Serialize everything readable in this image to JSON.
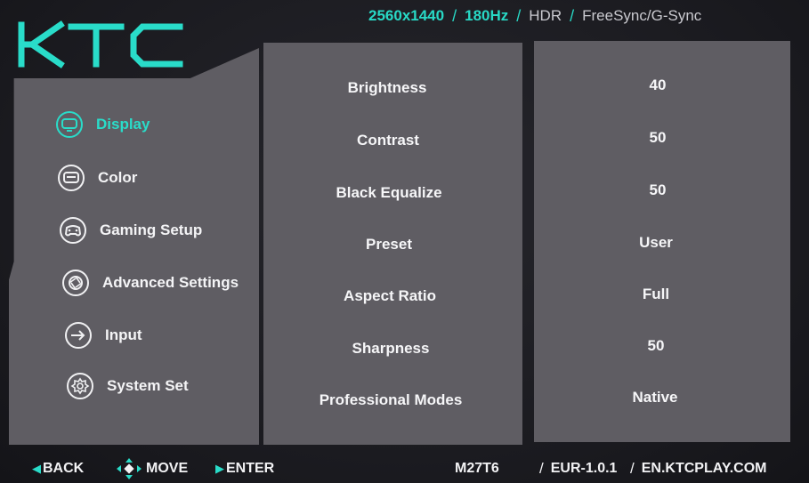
{
  "logo": {
    "text": "KTC",
    "color": "#29dcc9"
  },
  "specs": {
    "resolution": "2560x1440",
    "refresh": "180Hz",
    "hdr": "HDR",
    "sync": "FreeSync/G-Sync"
  },
  "nav": {
    "items": [
      {
        "label": "Display",
        "icon": "monitor-icon",
        "active": true
      },
      {
        "label": "Color",
        "icon": "color-palette-icon",
        "active": false
      },
      {
        "label": "Gaming Setup",
        "icon": "gamepad-icon",
        "active": false
      },
      {
        "label": "Advanced Settings",
        "icon": "aperture-icon",
        "active": false
      },
      {
        "label": "Input",
        "icon": "input-arrow-icon",
        "active": false
      },
      {
        "label": "System Set",
        "icon": "gear-icon",
        "active": false
      }
    ]
  },
  "settings": {
    "rows": [
      {
        "label": "Brightness",
        "value": "40"
      },
      {
        "label": "Contrast",
        "value": "50"
      },
      {
        "label": "Black Equalize",
        "value": "50"
      },
      {
        "label": "Preset",
        "value": "User"
      },
      {
        "label": "Aspect Ratio",
        "value": "Full"
      },
      {
        "label": "Sharpness",
        "value": "50"
      },
      {
        "label": "Professional Modes",
        "value": "Native"
      }
    ]
  },
  "footer": {
    "back": "BACK",
    "move": "MOVE",
    "enter": "ENTER",
    "model": "M27T6",
    "firmware": "EUR-1.0.1",
    "website": "EN.KTCPLAY.COM"
  },
  "colors": {
    "accent": "#29dcc9",
    "panel": "#5f5d63",
    "background": "#1b1b20"
  }
}
